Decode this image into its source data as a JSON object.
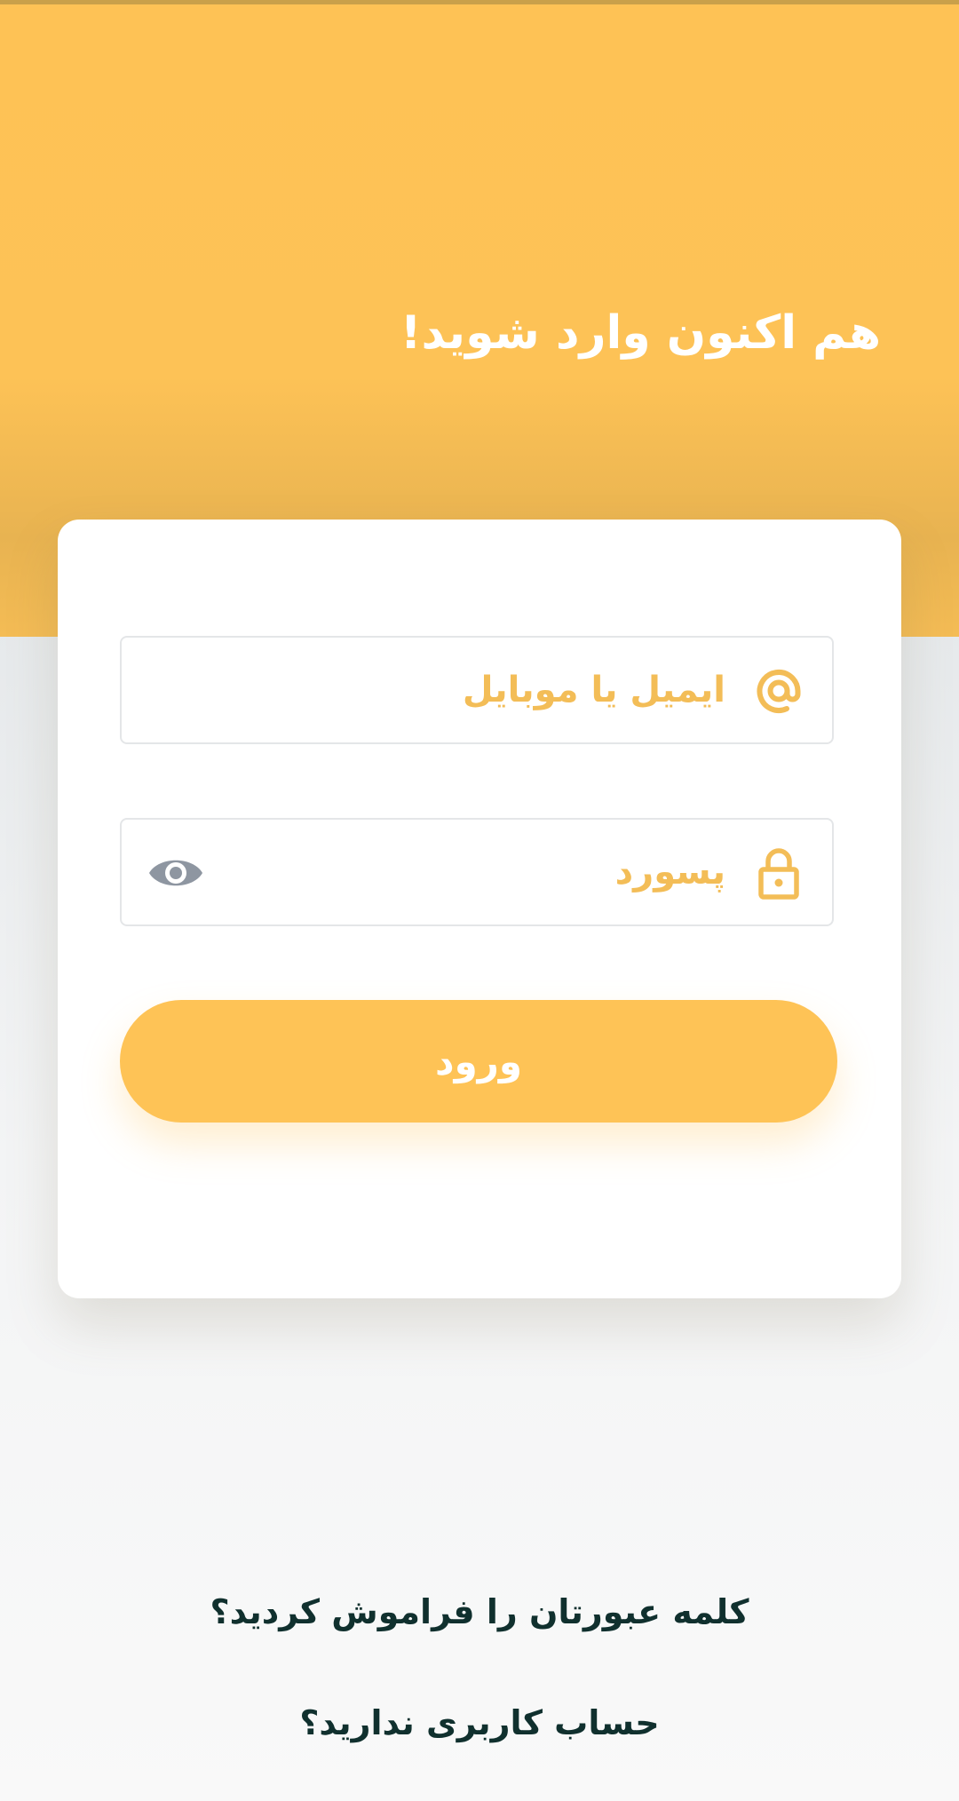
{
  "header": {
    "title": "هم اکنون وارد شوید!",
    "background_color": "#fec255"
  },
  "form": {
    "email": {
      "placeholder": "ایمیل یا موبایل",
      "value": "",
      "icon": "at-icon"
    },
    "password": {
      "placeholder": "پسورد",
      "value": "",
      "icon": "lock-icon",
      "toggle_icon": "eye-icon"
    },
    "login_label": "ورود"
  },
  "links": {
    "forgot_password": "کلمه عبورتان را فراموش کردید؟",
    "no_account": "حساب کاربری ندارید؟"
  },
  "colors": {
    "accent": "#fec356",
    "placeholder": "#f3bd57",
    "link_text": "#10302e",
    "icon_gray": "#8e96a1"
  }
}
